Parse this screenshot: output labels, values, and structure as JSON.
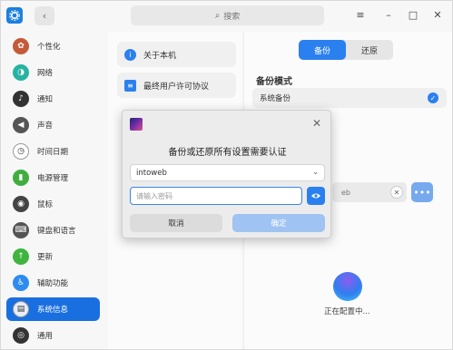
{
  "titlebar": {
    "search_placeholder": "搜索"
  },
  "sidebar": {
    "items": [
      {
        "label": "个性化",
        "icon": "personalization-icon",
        "color": "#c45a3a"
      },
      {
        "label": "网络",
        "icon": "network-icon",
        "color": "#27b3a2"
      },
      {
        "label": "通知",
        "icon": "bell-icon",
        "color": "#333333"
      },
      {
        "label": "声音",
        "icon": "speaker-icon",
        "color": "#555555"
      },
      {
        "label": "时间日期",
        "icon": "clock-icon",
        "color": "#ffffff"
      },
      {
        "label": "电源管理",
        "icon": "battery-icon",
        "color": "#3fae3f"
      },
      {
        "label": "鼠标",
        "icon": "mouse-icon",
        "color": "#444444"
      },
      {
        "label": "键盘和语言",
        "icon": "keyboard-icon",
        "color": "#555555"
      },
      {
        "label": "更新",
        "icon": "update-arrow-icon",
        "color": "#3fb43f"
      },
      {
        "label": "辅助功能",
        "icon": "accessibility-icon",
        "color": "#2e8bf0"
      },
      {
        "label": "系统信息",
        "icon": "system-info-icon",
        "color": "#e8eef8",
        "active": true
      },
      {
        "label": "通用",
        "icon": "general-icon",
        "color": "#333333"
      }
    ]
  },
  "middle": {
    "items": [
      {
        "label": "关于本机",
        "icon": "info-icon",
        "color": "#2b80f0"
      },
      {
        "label": "最终用户许可协议",
        "icon": "document-icon",
        "color": "#2b80f0"
      }
    ]
  },
  "right": {
    "tabs": [
      {
        "label": "备份",
        "active": true
      },
      {
        "label": "还原",
        "active": false
      }
    ],
    "section_title": "备份模式",
    "option_label": "系统备份",
    "path_value": "eb",
    "status_text": "正在配置中..."
  },
  "dialog": {
    "title": "备份或还原所有设置需要认证",
    "user_value": "intoweb",
    "password_placeholder": "请输入密码",
    "cancel_label": "取消",
    "confirm_label": "确定"
  },
  "colors": {
    "accent": "#2b80f0",
    "sidebar_active": "#1a6fe0",
    "confirm_disabled": "#9fc3f2"
  }
}
